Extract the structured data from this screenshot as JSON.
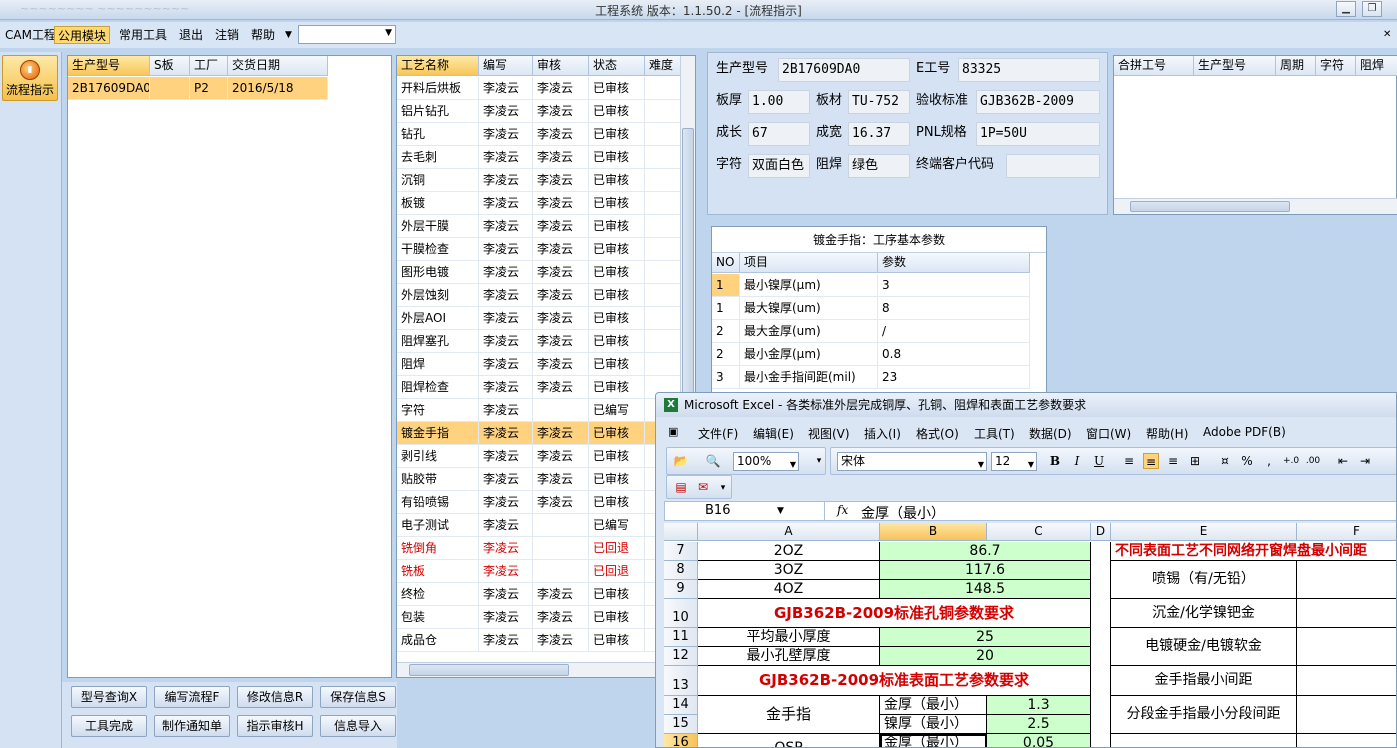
{
  "window": {
    "title": "工程系统 版本：1.1.50.2 - [流程指示]",
    "ghost": "~~~~~~~~ ~~~~~~~~~~"
  },
  "menu": {
    "items": [
      "CAM工程",
      "公用模块",
      "常用工具",
      "退出",
      "注销",
      "帮助"
    ],
    "active_index": 1
  },
  "left_toolbar": {
    "flow_button": "流程指示"
  },
  "orders": {
    "headers": [
      "生产型号",
      "S板",
      "工厂",
      "交货日期"
    ],
    "rows": [
      [
        "2B17609DA0",
        "",
        "P2",
        "2016/5/18"
      ]
    ]
  },
  "process": {
    "headers": [
      "工艺名称",
      "编写",
      "审核",
      "状态",
      "难度"
    ],
    "rows": [
      [
        "开料后烘板",
        "李凌云",
        "李凌云",
        "已审核",
        ""
      ],
      [
        "铝片钻孔",
        "李凌云",
        "李凌云",
        "已审核",
        ""
      ],
      [
        "钻孔",
        "李凌云",
        "李凌云",
        "已审核",
        ""
      ],
      [
        "去毛刺",
        "李凌云",
        "李凌云",
        "已审核",
        ""
      ],
      [
        "沉铜",
        "李凌云",
        "李凌云",
        "已审核",
        ""
      ],
      [
        "板镀",
        "李凌云",
        "李凌云",
        "已审核",
        ""
      ],
      [
        "外层干膜",
        "李凌云",
        "李凌云",
        "已审核",
        ""
      ],
      [
        "干膜检查",
        "李凌云",
        "李凌云",
        "已审核",
        ""
      ],
      [
        "图形电镀",
        "李凌云",
        "李凌云",
        "已审核",
        ""
      ],
      [
        "外层蚀刻",
        "李凌云",
        "李凌云",
        "已审核",
        ""
      ],
      [
        "外层AOI",
        "李凌云",
        "李凌云",
        "已审核",
        ""
      ],
      [
        "阻焊塞孔",
        "李凌云",
        "李凌云",
        "已审核",
        ""
      ],
      [
        "阻焊",
        "李凌云",
        "李凌云",
        "已审核",
        ""
      ],
      [
        "阻焊检查",
        "李凌云",
        "李凌云",
        "已审核",
        ""
      ],
      [
        "字符",
        "李凌云",
        "",
        "已编写",
        ""
      ],
      [
        "镀金手指",
        "李凌云",
        "李凌云",
        "已审核",
        ""
      ],
      [
        "剥引线",
        "李凌云",
        "李凌云",
        "已审核",
        ""
      ],
      [
        "贴胶带",
        "李凌云",
        "李凌云",
        "已审核",
        ""
      ],
      [
        "有铅喷锡",
        "李凌云",
        "李凌云",
        "已审核",
        ""
      ],
      [
        "电子测试",
        "李凌云",
        "",
        "已编写",
        ""
      ],
      [
        "铣倒角",
        "李凌云",
        "",
        "已回退",
        ""
      ],
      [
        "铣板",
        "李凌云",
        "",
        "已回退",
        ""
      ],
      [
        "终检",
        "李凌云",
        "李凌云",
        "已审核",
        ""
      ],
      [
        "包装",
        "李凌云",
        "李凌云",
        "已审核",
        ""
      ],
      [
        "成品仓",
        "李凌云",
        "李凌云",
        "已审核",
        ""
      ]
    ],
    "selected_index": 15,
    "red_indices": [
      20,
      21
    ]
  },
  "buttons": [
    "型号查询X",
    "编写流程F",
    "修改信息R",
    "保存信息S",
    "工具完成",
    "制作通知单",
    "指示审核H",
    "信息导入"
  ],
  "info": {
    "model_label": "生产型号",
    "model": "2B17609DA0",
    "eno_label": "E工号",
    "eno": "83325",
    "thick_label": "板厚",
    "thick": "1.00",
    "mat_label": "板材",
    "mat": "TU-752",
    "std_label": "验收标准",
    "std": "GJB362B-2009",
    "len_label": "成长",
    "len": "67",
    "wid_label": "成宽",
    "wid": "16.37",
    "pnl_label": "PNL规格",
    "pnl": "1P=50U",
    "char_label": "字符",
    "char": "双面白色",
    "mask_label": "阻焊",
    "mask": "绿色",
    "cust_label": "终端客户代码",
    "cust": ""
  },
  "merge": {
    "headers": [
      "合拼工号",
      "生产型号",
      "周期",
      "字符",
      "阻焊"
    ]
  },
  "op_params": {
    "title": "镀金手指：工序基本参数",
    "headers": [
      "NO",
      "项目",
      "参数"
    ],
    "rows": [
      [
        "1",
        "最小镍厚(μm)",
        "3"
      ],
      [
        "1",
        "最大镍厚(um)",
        "8"
      ],
      [
        "2",
        "最大金厚(um)",
        "/"
      ],
      [
        "2",
        "最小金厚(μm)",
        "0.8"
      ],
      [
        "3",
        "最小金手指间距(mil)",
        "23"
      ]
    ]
  },
  "excel": {
    "title": "Microsoft Excel - 各类标准外层完成铜厚、孔铜、阻焊和表面工艺参数要求",
    "menu": [
      "文件(F)",
      "编辑(E)",
      "视图(V)",
      "插入(I)",
      "格式(O)",
      "工具(T)",
      "数据(D)",
      "窗口(W)",
      "帮助(H)",
      "Adobe PDF(B)"
    ],
    "zoom": "100%",
    "font": "宋体",
    "size": "12",
    "namebox": "B16",
    "formula": "金厚（最小）",
    "cols": [
      "A",
      "B",
      "C",
      "D",
      "E",
      "F"
    ],
    "row_nums": [
      "7",
      "8",
      "9",
      "10",
      "11",
      "12",
      "13",
      "14",
      "15",
      "16"
    ],
    "cells": {
      "a7": "2OZ",
      "b7": "86.7",
      "a8": "3OZ",
      "b8": "117.6",
      "a9": "4OZ",
      "b9": "148.5",
      "a10": "GJB362B-2009标准孔铜参数要求",
      "a11": "平均最小厚度",
      "b11": "25",
      "a12": "最小孔壁厚度",
      "b12": "20",
      "a13": "GJB362B-2009标准表面工艺参数要求",
      "a14": "金手指",
      "b14": "金厚（最小）",
      "c14": "1.3",
      "b15": "镍厚（最小）",
      "c15": "2.5",
      "a16": "OSP",
      "b16": "金厚（最小）",
      "c16": "0.05",
      "e7": "不同表面工艺不同网络开窗焊盘最小间距",
      "e8": "喷锡（有/无铅）",
      "e10": "沉金/化学镍钯金",
      "e11": "电镀硬金/电镀软金",
      "e13": "金手指最小间距",
      "e14": "分段金手指最小分段间距"
    }
  }
}
